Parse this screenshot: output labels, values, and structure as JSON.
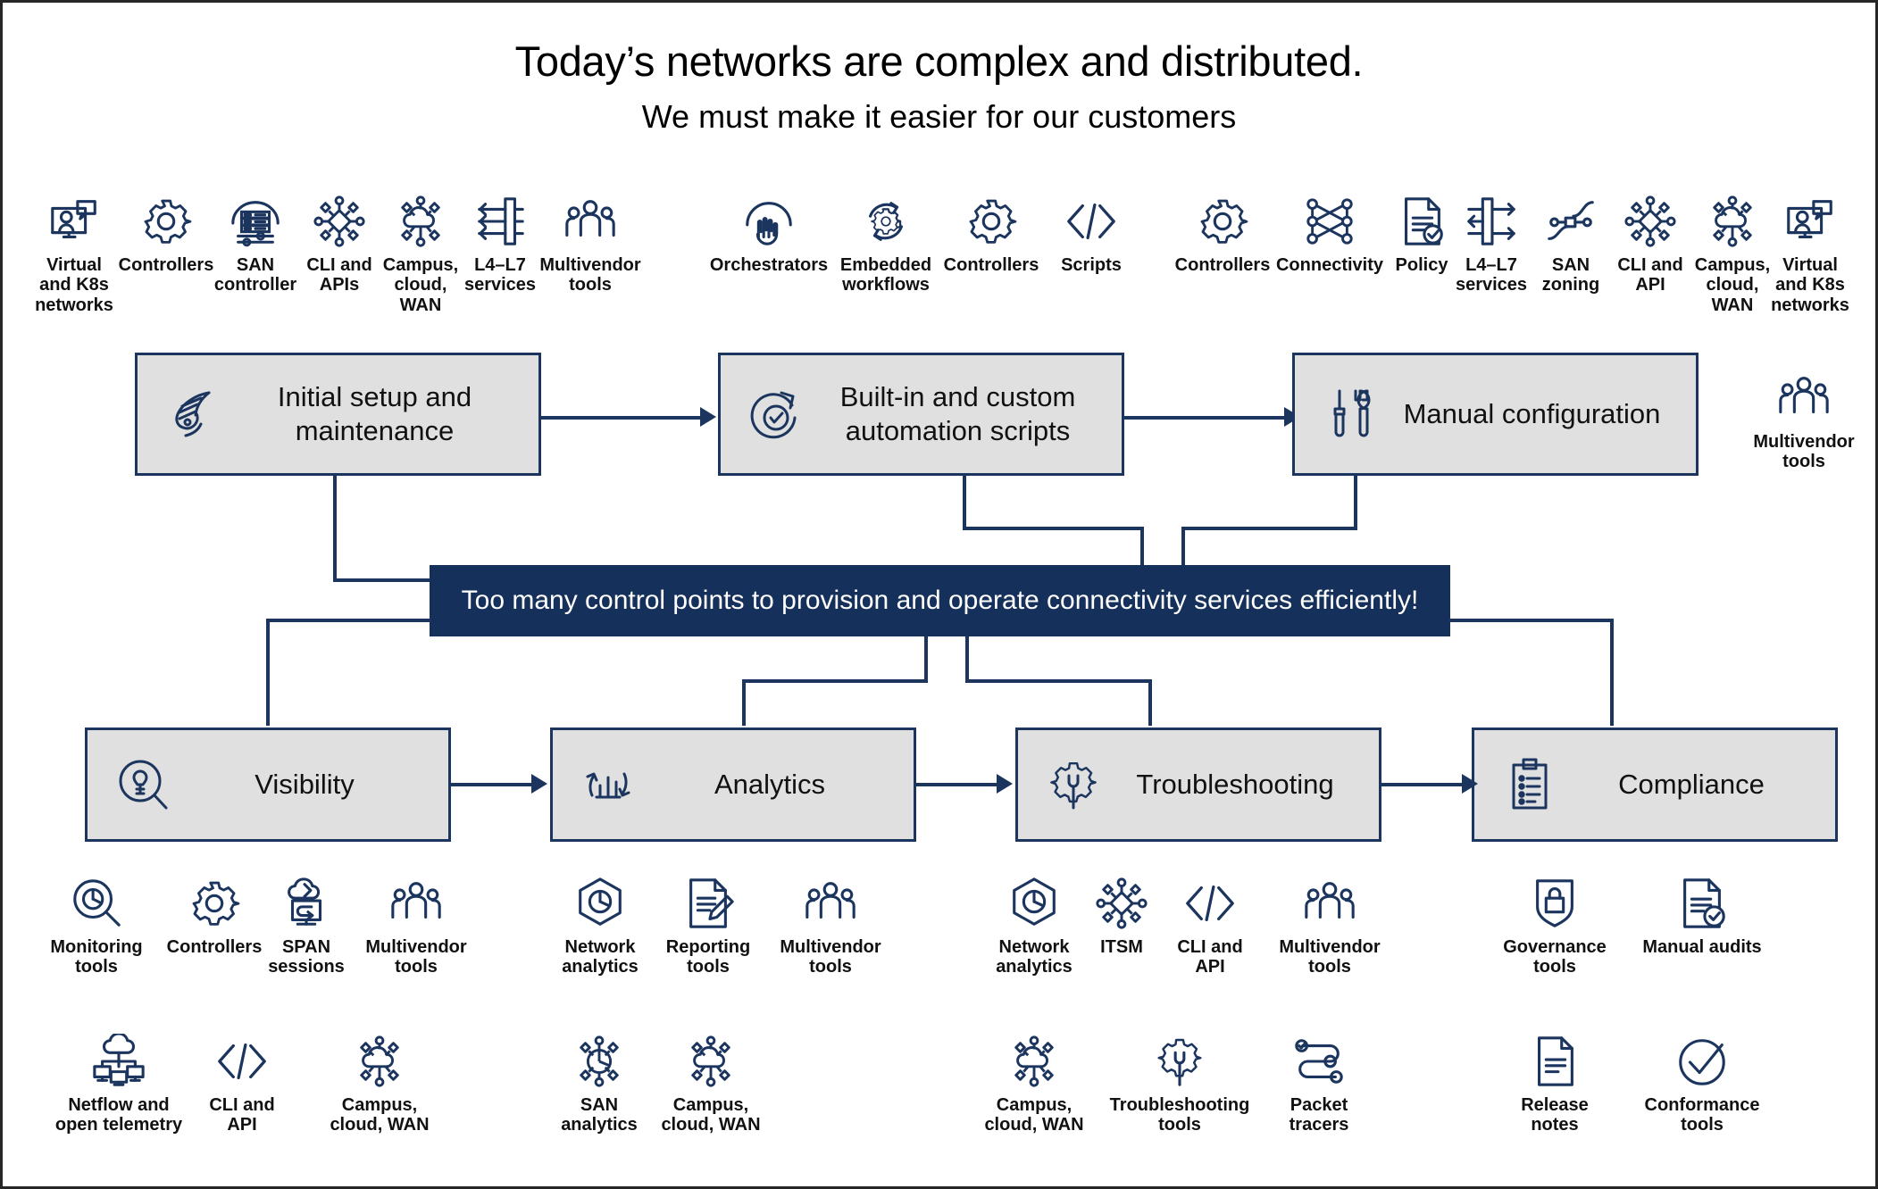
{
  "header": {
    "title": "Today’s networks are complex and distributed.",
    "subtitle": "We must make it easier for our customers"
  },
  "banner": {
    "text": "Too many control points to provision and operate connectivity services efficiently!",
    "bg_color": "#15305a",
    "text_color": "#ffffff"
  },
  "colors": {
    "accent": "#1b355e",
    "box_fill": "#e0e0e0",
    "box_border": "#1b355e",
    "icon_stroke": "#1b355e",
    "page_border": "#262626"
  },
  "process_row": {
    "boxes": [
      {
        "label": "Initial setup and\nmaintenance",
        "icon": "wing-feather-icon"
      },
      {
        "label": "Built-in and custom\nautomation scripts",
        "icon": "automation-refresh-check-icon"
      },
      {
        "label": "Manual configuration",
        "icon": "screwdriver-wrench-icon"
      }
    ]
  },
  "ops_row": {
    "boxes": [
      {
        "label": "Visibility",
        "icon": "lightbulb-magnifier-icon"
      },
      {
        "label": "Analytics",
        "icon": "bar-chart-cycle-icon"
      },
      {
        "label": "Troubleshooting",
        "icon": "gear-wrench-icon"
      },
      {
        "label": "Compliance",
        "icon": "clipboard-checklist-icon"
      }
    ]
  },
  "top_icons": {
    "group_setup": [
      {
        "label": "Virtual\nand K8s\nnetworks",
        "icon": "virtual-desktop-user-icon"
      },
      {
        "label": "Controllers",
        "icon": "gear-icon"
      },
      {
        "label": "SAN\ncontroller",
        "icon": "san-controller-icon"
      },
      {
        "label": "CLI and\nAPIs",
        "icon": "network-diamond-nodes-icon"
      },
      {
        "label": "Campus,\ncloud,\nWAN",
        "icon": "cloud-nodes-icon"
      },
      {
        "label": "L4–L7\nservices",
        "icon": "l4-l7-services-icon"
      },
      {
        "label": "Multivendor\ntools",
        "icon": "people-group-icon"
      }
    ],
    "group_automation": [
      {
        "label": "Orchestrators",
        "icon": "orchestrator-hand-icon"
      },
      {
        "label": "Embedded\nworkflows",
        "icon": "gear-refresh-icon"
      },
      {
        "label": "Controllers",
        "icon": "gear-icon"
      },
      {
        "label": "Scripts",
        "icon": "code-brackets-icon"
      }
    ],
    "group_manual": [
      {
        "label": "Controllers",
        "icon": "gear-icon"
      },
      {
        "label": "Connectivity",
        "icon": "mesh-connectivity-icon"
      },
      {
        "label": "Policy",
        "icon": "policy-document-check-icon"
      },
      {
        "label": "L4–L7\nservices",
        "icon": "l4-l7-services-icon"
      },
      {
        "label": "SAN\nzoning",
        "icon": "san-zoning-icon"
      },
      {
        "label": "CLI and\nAPI",
        "icon": "network-diamond-nodes-icon"
      },
      {
        "label": "Campus,\ncloud,\nWAN",
        "icon": "cloud-nodes-icon"
      },
      {
        "label": "Virtual\nand K8s\nnetworks",
        "icon": "virtual-desktop-user-icon"
      }
    ],
    "standalone": [
      {
        "label": "Multivendor\ntools",
        "icon": "people-group-icon"
      }
    ]
  },
  "bottom_icons": {
    "visibility": [
      {
        "label": "Monitoring\ntools",
        "icon": "pie-magnifier-icon"
      },
      {
        "label": "Controllers",
        "icon": "gear-icon"
      },
      {
        "label": "SPAN\nsessions",
        "icon": "span-session-cloud-icon"
      },
      {
        "label": "Multivendor\ntools",
        "icon": "people-group-icon"
      },
      {
        "label": "Netflow and\nopen telemetry",
        "icon": "cloud-telemetry-icon"
      },
      {
        "label": "CLI and\nAPI",
        "icon": "code-brackets-icon"
      },
      {
        "label": "Campus,\ncloud, WAN",
        "icon": "cloud-nodes-icon"
      }
    ],
    "analytics": [
      {
        "label": "Network\nanalytics",
        "icon": "hex-pie-icon"
      },
      {
        "label": "Reporting\ntools",
        "icon": "report-pencil-icon"
      },
      {
        "label": "Multivendor\ntools",
        "icon": "people-group-icon"
      },
      {
        "label": "SAN\nanalytics",
        "icon": "san-analytics-icon"
      },
      {
        "label": "Campus,\ncloud, WAN",
        "icon": "cloud-nodes-icon"
      }
    ],
    "troubleshooting": [
      {
        "label": "Network\nanalytics",
        "icon": "hex-pie-icon"
      },
      {
        "label": "ITSM",
        "icon": "network-diamond-nodes-icon"
      },
      {
        "label": "CLI and\nAPI",
        "icon": "code-brackets-icon"
      },
      {
        "label": "Multivendor\ntools",
        "icon": "people-group-icon"
      },
      {
        "label": "Campus,\ncloud, WAN",
        "icon": "cloud-nodes-icon"
      },
      {
        "label": "Troubleshooting\ntools",
        "icon": "gear-wrench-icon"
      },
      {
        "label": "Packet\ntracers",
        "icon": "packet-tracer-icon"
      }
    ],
    "compliance": [
      {
        "label": "Governance\ntools",
        "icon": "shield-lock-icon"
      },
      {
        "label": "Manual audits",
        "icon": "document-check-icon"
      },
      {
        "label": "Release\nnotes",
        "icon": "document-lines-icon"
      },
      {
        "label": "Conformance\ntools",
        "icon": "circle-check-icon"
      }
    ]
  }
}
